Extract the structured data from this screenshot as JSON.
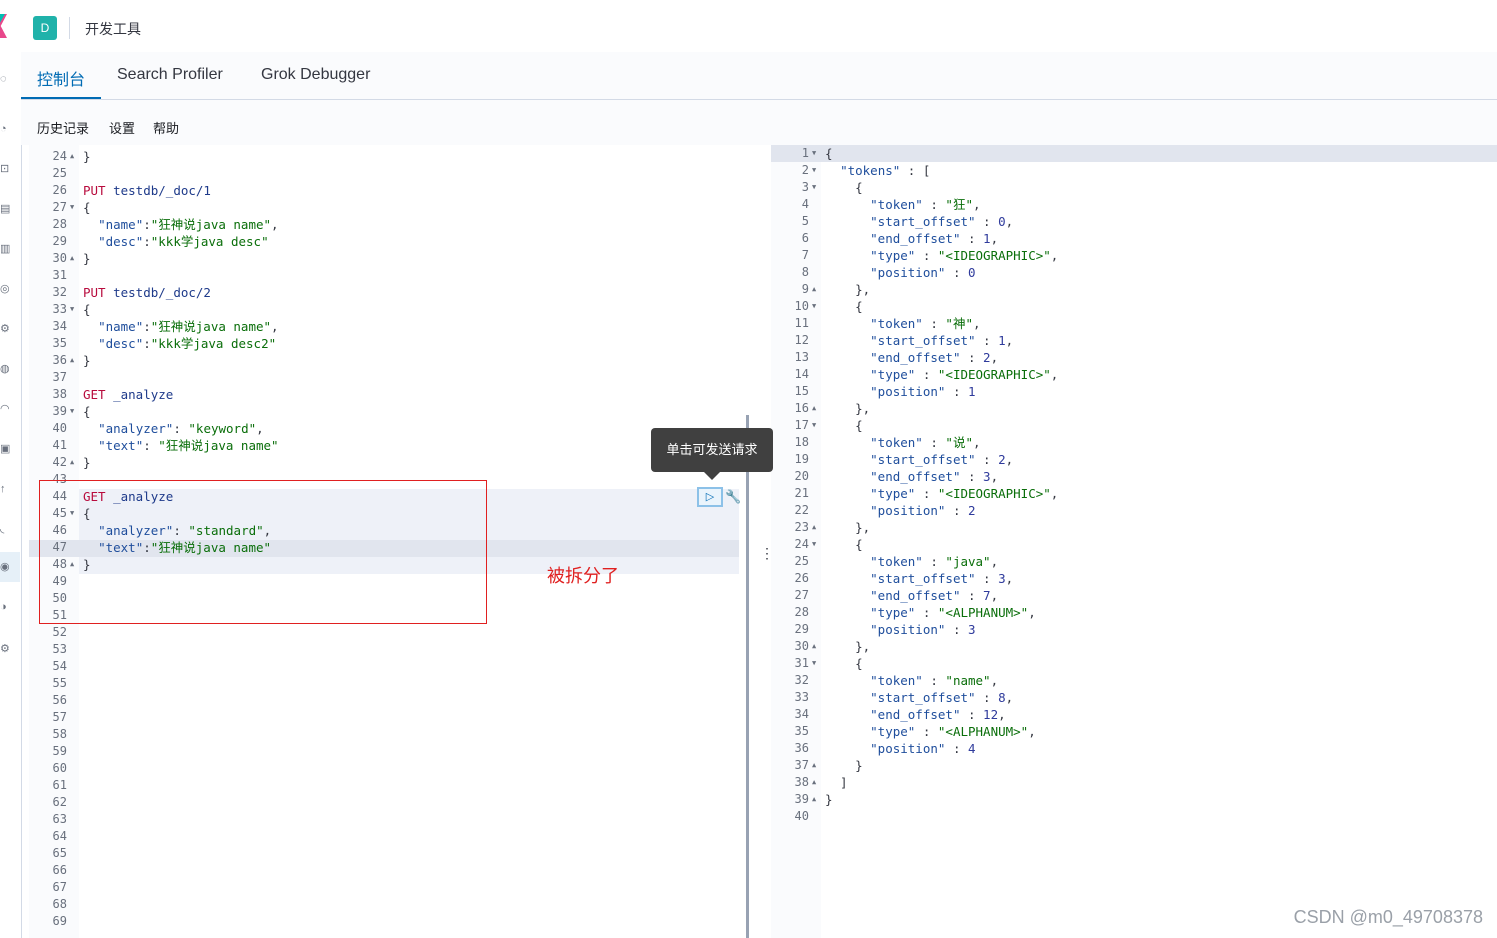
{
  "header": {
    "space_initial": "D",
    "title": "开发工具"
  },
  "tabs": [
    {
      "label": "控制台",
      "active": true
    },
    {
      "label": "Search Profiler",
      "active": false
    },
    {
      "label": "Grok Debugger",
      "active": false
    }
  ],
  "submenu": {
    "history": "历史记录",
    "settings": "设置",
    "help": "帮助"
  },
  "tooltip": "单击可发送请求",
  "annotation": "被拆分了",
  "watermark": "CSDN @m0_49708378",
  "left_editor": {
    "lines": [
      {
        "n": "24",
        "fold": "up",
        "t": [
          [
            "punc",
            "}"
          ]
        ]
      },
      {
        "n": "25",
        "t": []
      },
      {
        "n": "26",
        "t": [
          [
            "kw",
            "PUT"
          ],
          [
            "punc",
            " "
          ],
          [
            "url",
            "testdb/_doc/1"
          ]
        ]
      },
      {
        "n": "27",
        "fold": "down",
        "t": [
          [
            "punc",
            "{"
          ]
        ]
      },
      {
        "n": "28",
        "t": [
          [
            "punc",
            "  "
          ],
          [
            "key",
            "\"name\""
          ],
          [
            "punc",
            ":"
          ],
          [
            "str",
            "\"狂神说java name\""
          ],
          [
            "punc",
            ","
          ]
        ]
      },
      {
        "n": "29",
        "t": [
          [
            "punc",
            "  "
          ],
          [
            "key",
            "\"desc\""
          ],
          [
            "punc",
            ":"
          ],
          [
            "str",
            "\"kkk学java desc\""
          ]
        ]
      },
      {
        "n": "30",
        "fold": "up",
        "t": [
          [
            "punc",
            "}"
          ]
        ]
      },
      {
        "n": "31",
        "t": []
      },
      {
        "n": "32",
        "t": [
          [
            "kw",
            "PUT"
          ],
          [
            "punc",
            " "
          ],
          [
            "url",
            "testdb/_doc/2"
          ]
        ]
      },
      {
        "n": "33",
        "fold": "down",
        "t": [
          [
            "punc",
            "{"
          ]
        ]
      },
      {
        "n": "34",
        "t": [
          [
            "punc",
            "  "
          ],
          [
            "key",
            "\"name\""
          ],
          [
            "punc",
            ":"
          ],
          [
            "str",
            "\"狂神说java name\""
          ],
          [
            "punc",
            ","
          ]
        ]
      },
      {
        "n": "35",
        "t": [
          [
            "punc",
            "  "
          ],
          [
            "key",
            "\"desc\""
          ],
          [
            "punc",
            ":"
          ],
          [
            "str",
            "\"kkk学java desc2\""
          ]
        ]
      },
      {
        "n": "36",
        "fold": "up",
        "t": [
          [
            "punc",
            "}"
          ]
        ]
      },
      {
        "n": "37",
        "t": []
      },
      {
        "n": "38",
        "t": [
          [
            "kw",
            "GET"
          ],
          [
            "punc",
            " "
          ],
          [
            "url",
            "_analyze"
          ]
        ]
      },
      {
        "n": "39",
        "fold": "down",
        "t": [
          [
            "punc",
            "{"
          ]
        ]
      },
      {
        "n": "40",
        "t": [
          [
            "punc",
            "  "
          ],
          [
            "key",
            "\"analyzer\""
          ],
          [
            "punc",
            ": "
          ],
          [
            "str",
            "\"keyword\""
          ],
          [
            "punc",
            ","
          ]
        ]
      },
      {
        "n": "41",
        "t": [
          [
            "punc",
            "  "
          ],
          [
            "key",
            "\"text\""
          ],
          [
            "punc",
            ": "
          ],
          [
            "str",
            "\"狂神说java name\""
          ]
        ]
      },
      {
        "n": "42",
        "fold": "up",
        "t": [
          [
            "punc",
            "}"
          ]
        ]
      },
      {
        "n": "43",
        "t": []
      },
      {
        "n": "44",
        "t": [
          [
            "kw",
            "GET"
          ],
          [
            "punc",
            " "
          ],
          [
            "url",
            "_analyze"
          ]
        ]
      },
      {
        "n": "45",
        "fold": "down",
        "t": [
          [
            "punc",
            "{"
          ]
        ]
      },
      {
        "n": "46",
        "t": [
          [
            "punc",
            "  "
          ],
          [
            "key",
            "\"analyzer\""
          ],
          [
            "punc",
            ": "
          ],
          [
            "str",
            "\"standard\""
          ],
          [
            "punc",
            ","
          ]
        ]
      },
      {
        "n": "47",
        "t": [
          [
            "punc",
            "  "
          ],
          [
            "key",
            "\"text\""
          ],
          [
            "punc",
            ":"
          ],
          [
            "str",
            "\"狂神说java name\""
          ]
        ]
      },
      {
        "n": "48",
        "fold": "up",
        "t": [
          [
            "punc",
            "}"
          ]
        ]
      },
      {
        "n": "49",
        "t": []
      },
      {
        "n": "50",
        "t": []
      },
      {
        "n": "51",
        "t": []
      },
      {
        "n": "52",
        "t": []
      },
      {
        "n": "53",
        "t": []
      },
      {
        "n": "54",
        "t": []
      },
      {
        "n": "55",
        "t": []
      },
      {
        "n": "56",
        "t": []
      },
      {
        "n": "57",
        "t": []
      },
      {
        "n": "58",
        "t": []
      },
      {
        "n": "59",
        "t": []
      },
      {
        "n": "60",
        "t": []
      },
      {
        "n": "61",
        "t": []
      },
      {
        "n": "62",
        "t": []
      },
      {
        "n": "63",
        "t": []
      },
      {
        "n": "64",
        "t": []
      },
      {
        "n": "65",
        "t": []
      },
      {
        "n": "66",
        "t": []
      },
      {
        "n": "67",
        "t": []
      },
      {
        "n": "68",
        "t": []
      },
      {
        "n": "69",
        "t": []
      }
    ]
  },
  "right_editor": {
    "lines": [
      {
        "n": "1",
        "fold": "down",
        "t": [
          [
            "punc",
            "{"
          ]
        ]
      },
      {
        "n": "2",
        "fold": "down",
        "t": [
          [
            "punc",
            "  "
          ],
          [
            "key",
            "\"tokens\""
          ],
          [
            "punc",
            " : ["
          ]
        ]
      },
      {
        "n": "3",
        "fold": "down",
        "t": [
          [
            "punc",
            "    {"
          ]
        ]
      },
      {
        "n": "4",
        "t": [
          [
            "punc",
            "      "
          ],
          [
            "key",
            "\"token\""
          ],
          [
            "punc",
            " : "
          ],
          [
            "str",
            "\"狂\""
          ],
          [
            "punc",
            ","
          ]
        ]
      },
      {
        "n": "5",
        "t": [
          [
            "punc",
            "      "
          ],
          [
            "key",
            "\"start_offset\""
          ],
          [
            "punc",
            " : "
          ],
          [
            "num",
            "0"
          ],
          [
            "punc",
            ","
          ]
        ]
      },
      {
        "n": "6",
        "t": [
          [
            "punc",
            "      "
          ],
          [
            "key",
            "\"end_offset\""
          ],
          [
            "punc",
            " : "
          ],
          [
            "num",
            "1"
          ],
          [
            "punc",
            ","
          ]
        ]
      },
      {
        "n": "7",
        "t": [
          [
            "punc",
            "      "
          ],
          [
            "key",
            "\"type\""
          ],
          [
            "punc",
            " : "
          ],
          [
            "str",
            "\"<IDEOGRAPHIC>\""
          ],
          [
            "punc",
            ","
          ]
        ]
      },
      {
        "n": "8",
        "t": [
          [
            "punc",
            "      "
          ],
          [
            "key",
            "\"position\""
          ],
          [
            "punc",
            " : "
          ],
          [
            "num",
            "0"
          ]
        ]
      },
      {
        "n": "9",
        "fold": "up",
        "t": [
          [
            "punc",
            "    },"
          ]
        ]
      },
      {
        "n": "10",
        "fold": "down",
        "t": [
          [
            "punc",
            "    {"
          ]
        ]
      },
      {
        "n": "11",
        "t": [
          [
            "punc",
            "      "
          ],
          [
            "key",
            "\"token\""
          ],
          [
            "punc",
            " : "
          ],
          [
            "str",
            "\"神\""
          ],
          [
            "punc",
            ","
          ]
        ]
      },
      {
        "n": "12",
        "t": [
          [
            "punc",
            "      "
          ],
          [
            "key",
            "\"start_offset\""
          ],
          [
            "punc",
            " : "
          ],
          [
            "num",
            "1"
          ],
          [
            "punc",
            ","
          ]
        ]
      },
      {
        "n": "13",
        "t": [
          [
            "punc",
            "      "
          ],
          [
            "key",
            "\"end_offset\""
          ],
          [
            "punc",
            " : "
          ],
          [
            "num",
            "2"
          ],
          [
            "punc",
            ","
          ]
        ]
      },
      {
        "n": "14",
        "t": [
          [
            "punc",
            "      "
          ],
          [
            "key",
            "\"type\""
          ],
          [
            "punc",
            " : "
          ],
          [
            "str",
            "\"<IDEOGRAPHIC>\""
          ],
          [
            "punc",
            ","
          ]
        ]
      },
      {
        "n": "15",
        "t": [
          [
            "punc",
            "      "
          ],
          [
            "key",
            "\"position\""
          ],
          [
            "punc",
            " : "
          ],
          [
            "num",
            "1"
          ]
        ]
      },
      {
        "n": "16",
        "fold": "up",
        "t": [
          [
            "punc",
            "    },"
          ]
        ]
      },
      {
        "n": "17",
        "fold": "down",
        "t": [
          [
            "punc",
            "    {"
          ]
        ]
      },
      {
        "n": "18",
        "t": [
          [
            "punc",
            "      "
          ],
          [
            "key",
            "\"token\""
          ],
          [
            "punc",
            " : "
          ],
          [
            "str",
            "\"说\""
          ],
          [
            "punc",
            ","
          ]
        ]
      },
      {
        "n": "19",
        "t": [
          [
            "punc",
            "      "
          ],
          [
            "key",
            "\"start_offset\""
          ],
          [
            "punc",
            " : "
          ],
          [
            "num",
            "2"
          ],
          [
            "punc",
            ","
          ]
        ]
      },
      {
        "n": "20",
        "t": [
          [
            "punc",
            "      "
          ],
          [
            "key",
            "\"end_offset\""
          ],
          [
            "punc",
            " : "
          ],
          [
            "num",
            "3"
          ],
          [
            "punc",
            ","
          ]
        ]
      },
      {
        "n": "21",
        "t": [
          [
            "punc",
            "      "
          ],
          [
            "key",
            "\"type\""
          ],
          [
            "punc",
            " : "
          ],
          [
            "str",
            "\"<IDEOGRAPHIC>\""
          ],
          [
            "punc",
            ","
          ]
        ]
      },
      {
        "n": "22",
        "t": [
          [
            "punc",
            "      "
          ],
          [
            "key",
            "\"position\""
          ],
          [
            "punc",
            " : "
          ],
          [
            "num",
            "2"
          ]
        ]
      },
      {
        "n": "23",
        "fold": "up",
        "t": [
          [
            "punc",
            "    },"
          ]
        ]
      },
      {
        "n": "24",
        "fold": "down",
        "t": [
          [
            "punc",
            "    {"
          ]
        ]
      },
      {
        "n": "25",
        "t": [
          [
            "punc",
            "      "
          ],
          [
            "key",
            "\"token\""
          ],
          [
            "punc",
            " : "
          ],
          [
            "str",
            "\"java\""
          ],
          [
            "punc",
            ","
          ]
        ]
      },
      {
        "n": "26",
        "t": [
          [
            "punc",
            "      "
          ],
          [
            "key",
            "\"start_offset\""
          ],
          [
            "punc",
            " : "
          ],
          [
            "num",
            "3"
          ],
          [
            "punc",
            ","
          ]
        ]
      },
      {
        "n": "27",
        "t": [
          [
            "punc",
            "      "
          ],
          [
            "key",
            "\"end_offset\""
          ],
          [
            "punc",
            " : "
          ],
          [
            "num",
            "7"
          ],
          [
            "punc",
            ","
          ]
        ]
      },
      {
        "n": "28",
        "t": [
          [
            "punc",
            "      "
          ],
          [
            "key",
            "\"type\""
          ],
          [
            "punc",
            " : "
          ],
          [
            "str",
            "\"<ALPHANUM>\""
          ],
          [
            "punc",
            ","
          ]
        ]
      },
      {
        "n": "29",
        "t": [
          [
            "punc",
            "      "
          ],
          [
            "key",
            "\"position\""
          ],
          [
            "punc",
            " : "
          ],
          [
            "num",
            "3"
          ]
        ]
      },
      {
        "n": "30",
        "fold": "up",
        "t": [
          [
            "punc",
            "    },"
          ]
        ]
      },
      {
        "n": "31",
        "fold": "down",
        "t": [
          [
            "punc",
            "    {"
          ]
        ]
      },
      {
        "n": "32",
        "t": [
          [
            "punc",
            "      "
          ],
          [
            "key",
            "\"token\""
          ],
          [
            "punc",
            " : "
          ],
          [
            "str",
            "\"name\""
          ],
          [
            "punc",
            ","
          ]
        ]
      },
      {
        "n": "33",
        "t": [
          [
            "punc",
            "      "
          ],
          [
            "key",
            "\"start_offset\""
          ],
          [
            "punc",
            " : "
          ],
          [
            "num",
            "8"
          ],
          [
            "punc",
            ","
          ]
        ]
      },
      {
        "n": "34",
        "t": [
          [
            "punc",
            "      "
          ],
          [
            "key",
            "\"end_offset\""
          ],
          [
            "punc",
            " : "
          ],
          [
            "num",
            "12"
          ],
          [
            "punc",
            ","
          ]
        ]
      },
      {
        "n": "35",
        "t": [
          [
            "punc",
            "      "
          ],
          [
            "key",
            "\"type\""
          ],
          [
            "punc",
            " : "
          ],
          [
            "str",
            "\"<ALPHANUM>\""
          ],
          [
            "punc",
            ","
          ]
        ]
      },
      {
        "n": "36",
        "t": [
          [
            "punc",
            "      "
          ],
          [
            "key",
            "\"position\""
          ],
          [
            "punc",
            " : "
          ],
          [
            "num",
            "4"
          ]
        ]
      },
      {
        "n": "37",
        "fold": "up",
        "t": [
          [
            "punc",
            "    }"
          ]
        ]
      },
      {
        "n": "38",
        "fold": "up",
        "t": [
          [
            "punc",
            "  ]"
          ]
        ]
      },
      {
        "n": "39",
        "fold": "up",
        "t": [
          [
            "punc",
            "}"
          ]
        ]
      },
      {
        "n": "40",
        "t": []
      }
    ]
  }
}
